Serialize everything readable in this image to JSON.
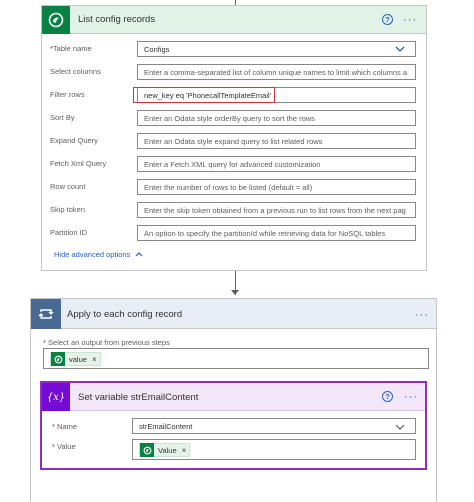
{
  "list_config": {
    "title": "List config records",
    "help": "?",
    "more": "···",
    "fields": [
      {
        "label": "Table name",
        "required": true,
        "value": "Configs",
        "is_value": true,
        "dropdown": true
      },
      {
        "label": "Select columns",
        "value": "Enter a comma-separated list of column unique names to limit which columns a"
      },
      {
        "label": "Filter rows",
        "value": "new_key eq 'PhonecallTemplateEmail'",
        "is_value": true,
        "highlighted": true
      },
      {
        "label": "Sort By",
        "value": "Enter an Odata style orderBy query to sort the rows"
      },
      {
        "label": "Expand Query",
        "value": "Enter an Odata style expand query to list related rows"
      },
      {
        "label": "Fetch Xml Query",
        "value": "Enter a Fetch XML query for advanced customization"
      },
      {
        "label": "Row count",
        "value": "Enter the number of rows to be listed (default = all)"
      },
      {
        "label": "Skip token",
        "value": "Enter the skip token obtained from a previous run to list rows from the next pag"
      },
      {
        "label": "Partition ID",
        "value": "An option to specify the partitionId while retrieving data for NoSQL tables"
      }
    ],
    "hide_advanced": "Hide advanced options",
    "req_mark": "*"
  },
  "apply_each": {
    "title": "Apply to each config record",
    "more": "···",
    "prev_label": "Select an output from previous steps",
    "token": "value",
    "token_x": "×",
    "req_mark": "*"
  },
  "set_variable": {
    "title": "Set variable strEmailContent",
    "icon_text": "{x}",
    "help": "?",
    "more": "···",
    "name_label": "Name",
    "name_value": "strEmailContent",
    "value_label": "Value",
    "value_token": "Value",
    "token_x": "×",
    "req_mark": "*"
  },
  "colors": {
    "dataverse_green": "#088142",
    "loop_blue": "#486991",
    "variable_purple": "#770bd6",
    "link_blue": "#2a63c0",
    "highlight_red": "#d13438"
  }
}
